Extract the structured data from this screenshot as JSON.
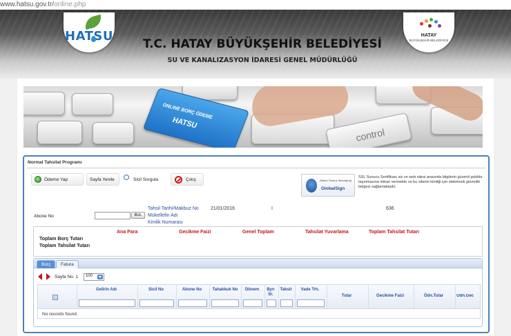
{
  "browser": {
    "url_host": "www.hatsu.gov.tr/",
    "url_path": "online.php"
  },
  "header": {
    "logo_left_text": "HATSU",
    "logo_right_title": "HATAY",
    "logo_right_subtitle": "BÜYÜKŞEHİR BELEDİYESİ",
    "title": "T.C. HATAY BÜYÜKŞEHİR BELEDİYESİ",
    "subtitle": "SU VE KANALIZASYON İDARESİ GENEL MÜDÜRLÜĞÜ"
  },
  "banner": {
    "key_line1": "ONLINE BORÇ ÖDEME",
    "key_line2": "HATSU",
    "control_key": "control"
  },
  "panel": {
    "title": "Normal Tahsilat Programı",
    "toolbar": {
      "pay_label": "Ödeme Yap",
      "refresh_label": "Sayfa Yenile",
      "query_label": "Sicil Sorgula",
      "exit_label": "Çıkış"
    },
    "ssl": {
      "seal_small": "Online Trust & Security by",
      "seal_brand": "GlobalSign",
      "text": "SSL Sunucu Sertifikası siz ve web sitesi arasında bilgilerin güvenli şekilde taşınmasına imkan vermekte ve bu sitenin kimliği için elektronik güvenlik belgesi sağlamaktadır."
    },
    "form": {
      "abone_label": "Abone No",
      "abone_value": "",
      "search_button": "BUL",
      "receipt_label": "Tahsil Tarihi/Makbuz No",
      "receipt_date": "21/01/2016",
      "receipt_sep": "I",
      "receipt_no": "636",
      "payer_label": "Mükellefin Adı",
      "id_label": "Kimlik Numarası"
    },
    "summary": {
      "headers": [
        "Ana Para",
        "Gecikme Faizi",
        "Genel Toplam",
        "Tahsilat Yuvarlama",
        "Toplam Tahsilat Tutarı"
      ],
      "row1": "Toplam Borç Tutarı",
      "row2": "Toplam Tahsilat Tutarı"
    },
    "tabs": [
      {
        "label": "Borç",
        "active": true
      },
      {
        "label": "Fatura",
        "active": false
      }
    ],
    "pager": {
      "page_label": "Sayfa No. 1",
      "page_size": "100"
    },
    "grid": {
      "columns": [
        "Gelirin Adı",
        "Sicil No",
        "Abone No",
        "Tahakkuk No",
        "Dönem",
        "Byn Sr.",
        "Taksit",
        "Vade Trh.",
        "Tutar",
        "Gecikme Faizi",
        "Ödn.Tutar",
        "Ödn.Gec"
      ],
      "empty_text": "No records found."
    }
  },
  "colors": {
    "accent_blue": "#4a7fc1",
    "header_red": "#c0181a",
    "link_blue": "#2a4e9c"
  }
}
